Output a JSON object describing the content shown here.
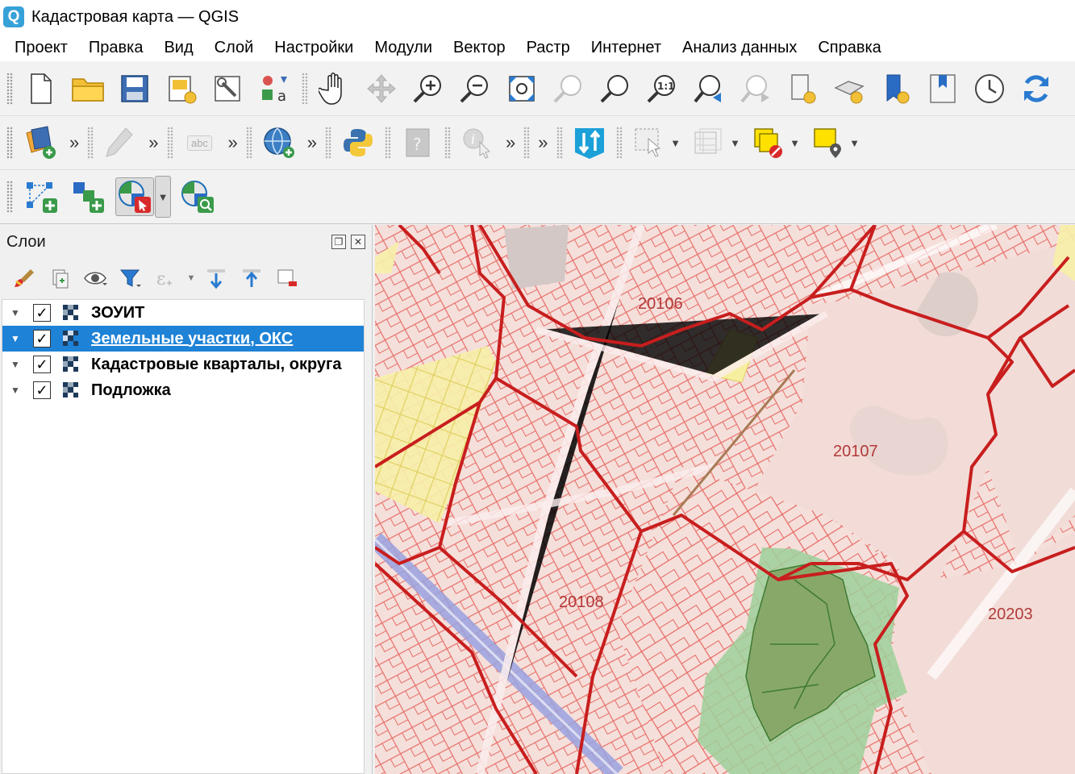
{
  "window": {
    "title": "Кадастровая карта — QGIS",
    "app_icon_letter": "Q"
  },
  "menu": [
    "Проект",
    "Правка",
    "Вид",
    "Слой",
    "Настройки",
    "Модули",
    "Вектор",
    "Растр",
    "Интернет",
    "Анализ данных",
    "Справка"
  ],
  "toolbar": {
    "more_symbol": "»",
    "label_tool_text": "abc"
  },
  "layers_panel": {
    "title": "Слои",
    "layers": [
      {
        "name": "ЗОУИТ",
        "checked": true,
        "selected": false
      },
      {
        "name": "Земельные участки, ОКС",
        "checked": true,
        "selected": true
      },
      {
        "name": "Кадастровые кварталы, округа",
        "checked": true,
        "selected": false
      },
      {
        "name": "Подложка",
        "checked": true,
        "selected": false
      }
    ],
    "checkmark": "✓",
    "expander": "▼"
  },
  "map": {
    "labels": [
      "20106",
      "20107",
      "20108",
      "20203"
    ],
    "colors": {
      "parcel_stroke": "#e0403a",
      "boundary_stroke": "#c81e1e",
      "zouit_yellow": "#f7f0a8",
      "zouit_green": "#9ed09a",
      "road_blue": "#9aa3e0",
      "base": "#f5e1dd"
    }
  }
}
